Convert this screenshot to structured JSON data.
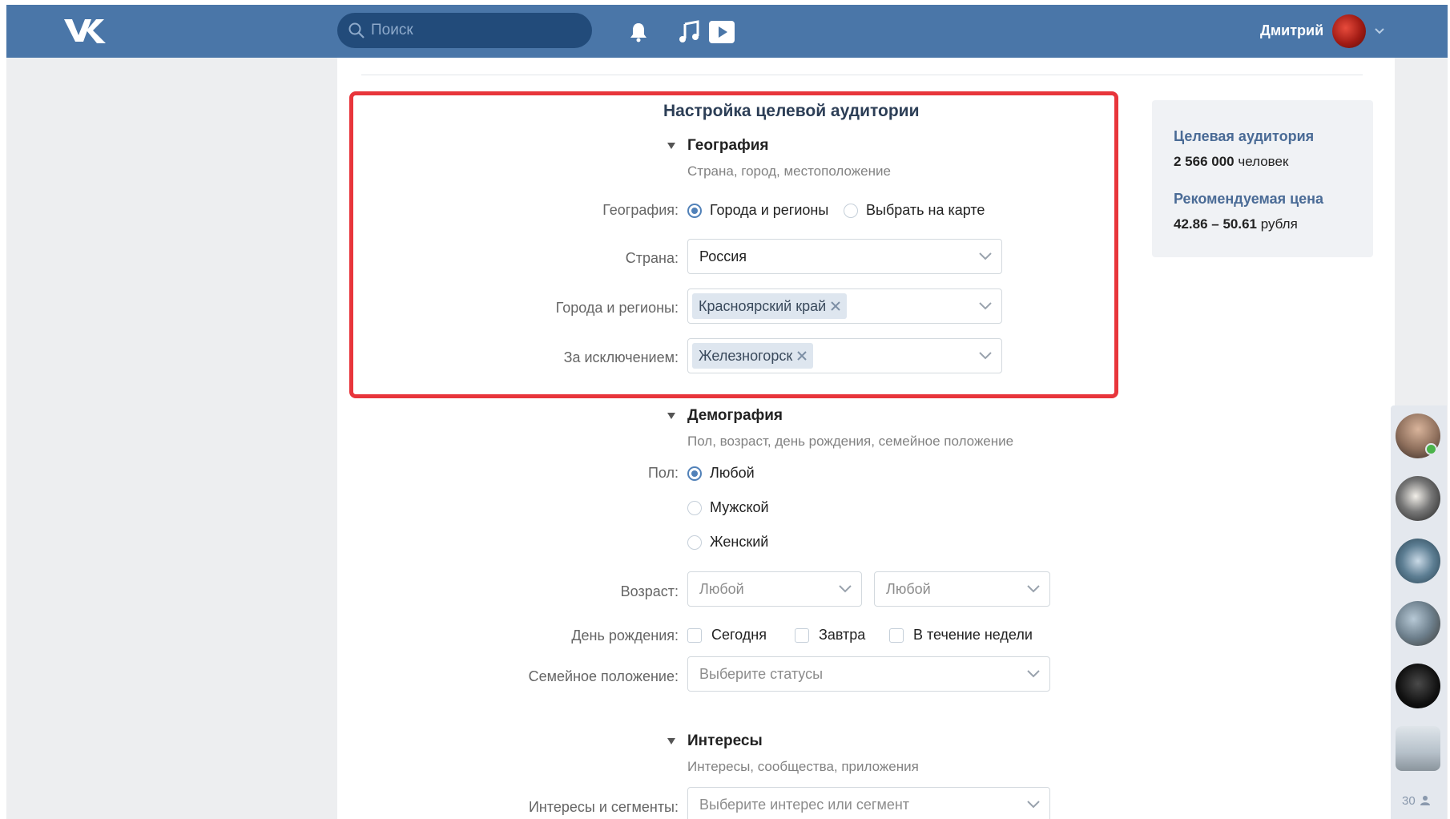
{
  "header": {
    "search_placeholder": "Поиск",
    "user_name": "Дмитрий"
  },
  "form": {
    "title": "Настройка целевой аудитории",
    "geography": {
      "heading": "География",
      "subtitle": "Страна, город, местоположение",
      "label": "География:",
      "options": [
        "Города и регионы",
        "Выбрать на карте"
      ],
      "selected": "Города и регионы",
      "country_label": "Страна:",
      "country_value": "Россия",
      "cities_label": "Города и регионы:",
      "cities_tag": "Красноярский край",
      "except_label": "За исключением:",
      "except_tag": "Железногорск"
    },
    "demography": {
      "heading": "Демография",
      "subtitle": "Пол, возраст, день рождения, семейное положение",
      "gender_label": "Пол:",
      "gender_options": [
        "Любой",
        "Мужской",
        "Женский"
      ],
      "gender_selected": "Любой",
      "age_label": "Возраст:",
      "age_from": "Любой",
      "age_to": "Любой",
      "birthday_label": "День рождения:",
      "birthday_options": [
        "Сегодня",
        "Завтра",
        "В течение недели"
      ],
      "marital_label": "Семейное положение:",
      "marital_placeholder": "Выберите статусы"
    },
    "interests": {
      "heading": "Интересы",
      "subtitle": "Интересы, сообщества, приложения",
      "segments_label": "Интересы и сегменты:",
      "segments_placeholder": "Выберите интерес или сегмент"
    }
  },
  "sidebar": {
    "audience_heading": "Целевая аудитория",
    "audience_number": "2 566 000",
    "audience_unit": "человек",
    "price_heading": "Рекомендуемая цена",
    "price_range": "42.86 – 50.61",
    "price_unit": "рубля"
  },
  "friends_list": {
    "count": "30"
  },
  "colors": {
    "header_bg": "#4a76a8",
    "accent": "#5181b8",
    "highlight_border": "#e8353b"
  }
}
